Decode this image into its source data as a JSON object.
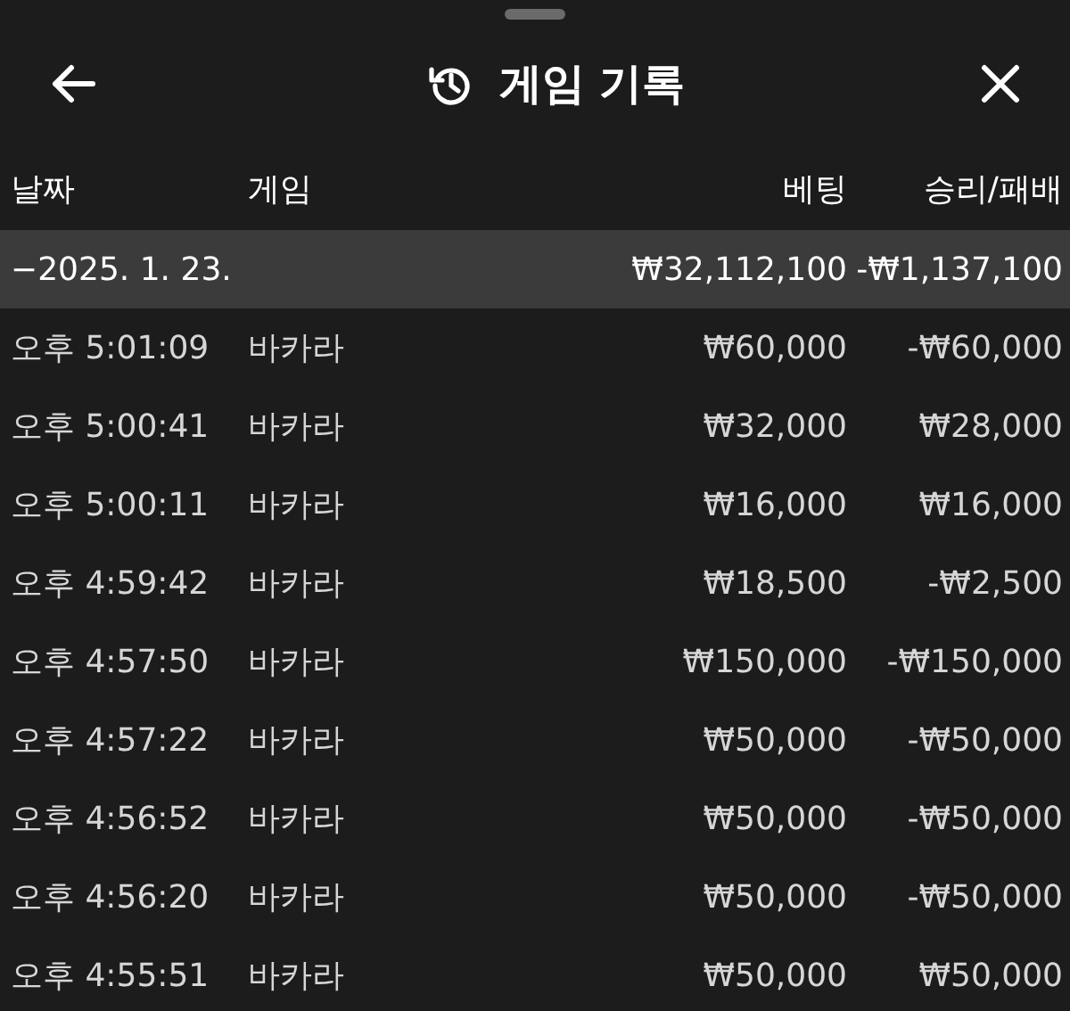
{
  "header": {
    "title": "게임 기록"
  },
  "columns": [
    "날짜",
    "게임",
    "베팅",
    "승리/패배"
  ],
  "groups": [
    {
      "toggle": "−",
      "date": "2025. 1. 23.",
      "expanded": true,
      "bet": "₩32,112,100",
      "result": "-₩1,137,100",
      "rows": [
        {
          "time": "오후 5:01:09",
          "game": "바카라",
          "bet": "₩60,000",
          "result": "-₩60,000"
        },
        {
          "time": "오후 5:00:41",
          "game": "바카라",
          "bet": "₩32,000",
          "result": "₩28,000"
        },
        {
          "time": "오후 5:00:11",
          "game": "바카라",
          "bet": "₩16,000",
          "result": "₩16,000"
        },
        {
          "time": "오후 4:59:42",
          "game": "바카라",
          "bet": "₩18,500",
          "result": "-₩2,500"
        },
        {
          "time": "오후 4:57:50",
          "game": "바카라",
          "bet": "₩150,000",
          "result": "-₩150,000"
        },
        {
          "time": "오후 4:57:22",
          "game": "바카라",
          "bet": "₩50,000",
          "result": "-₩50,000"
        },
        {
          "time": "오후 4:56:52",
          "game": "바카라",
          "bet": "₩50,000",
          "result": "-₩50,000"
        },
        {
          "time": "오후 4:56:20",
          "game": "바카라",
          "bet": "₩50,000",
          "result": "-₩50,000"
        },
        {
          "time": "오후 4:55:51",
          "game": "바카라",
          "bet": "₩50,000",
          "result": "₩50,000"
        }
      ]
    }
  ]
}
